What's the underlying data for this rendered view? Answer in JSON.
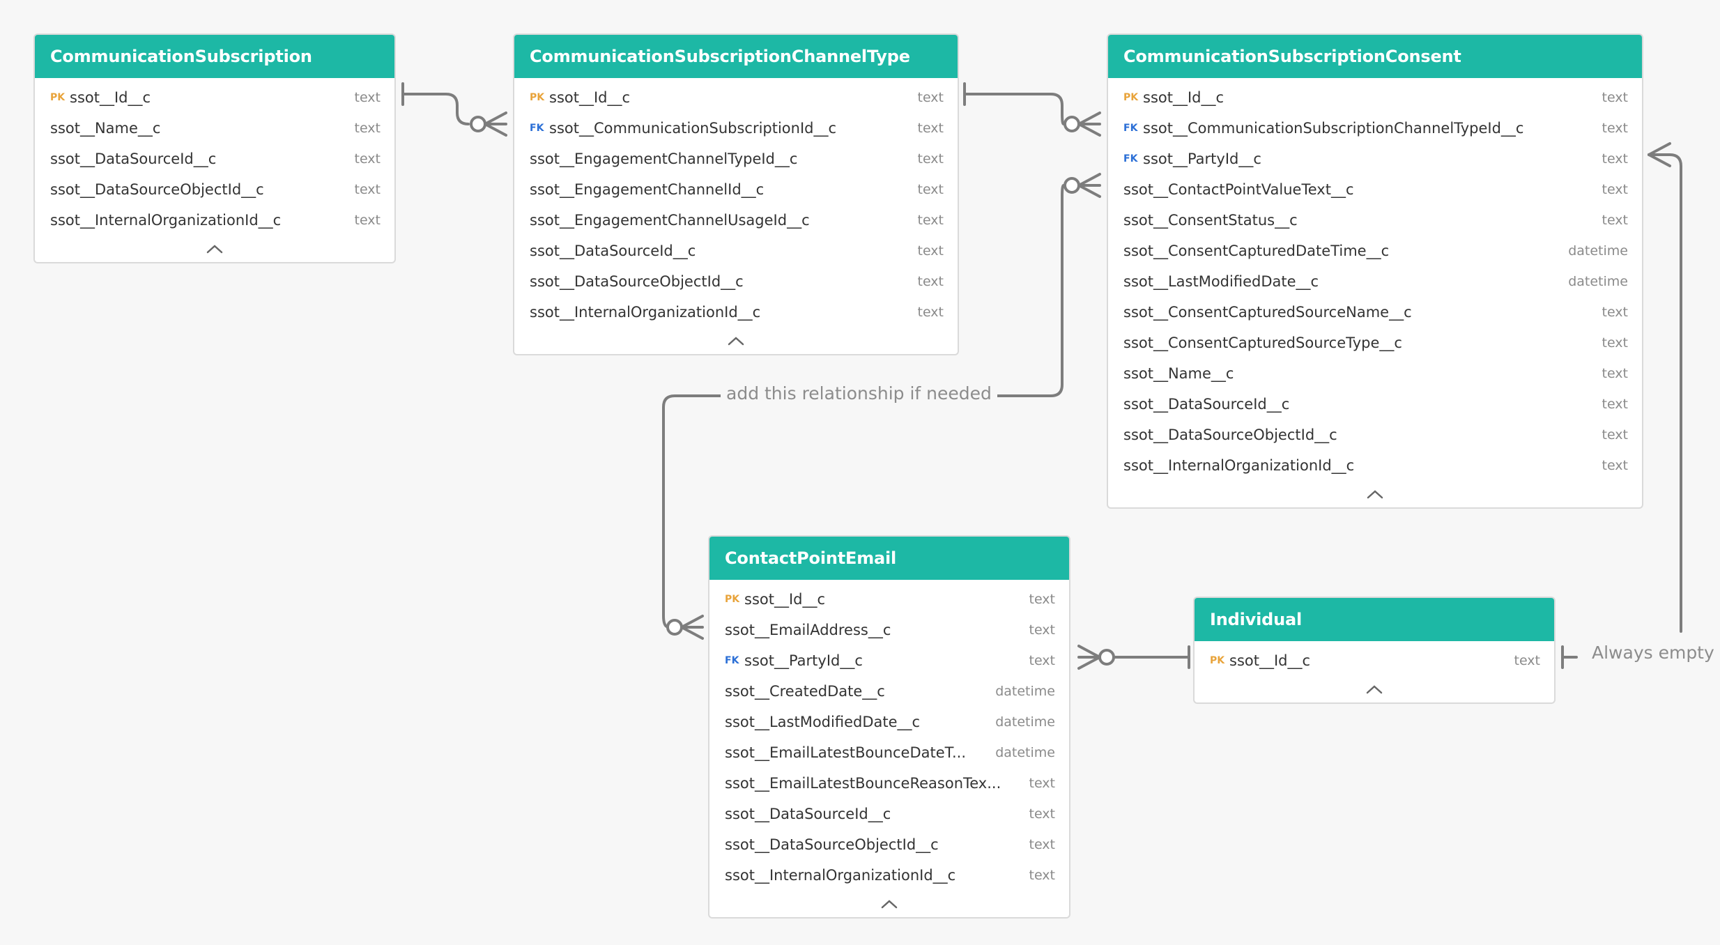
{
  "entities": {
    "communication_subscription": {
      "title": "CommunicationSubscription",
      "fields": [
        {
          "key": "PK",
          "name": "ssot__Id__c",
          "type": "text"
        },
        {
          "key": "",
          "name": "ssot__Name__c",
          "type": "text"
        },
        {
          "key": "",
          "name": "ssot__DataSourceId__c",
          "type": "text"
        },
        {
          "key": "",
          "name": "ssot__DataSourceObjectId__c",
          "type": "text"
        },
        {
          "key": "",
          "name": "ssot__InternalOrganizationId__c",
          "type": "text"
        }
      ]
    },
    "channel_type": {
      "title": "CommunicationSubscriptionChannelType",
      "fields": [
        {
          "key": "PK",
          "name": "ssot__Id__c",
          "type": "text"
        },
        {
          "key": "FK",
          "name": "ssot__CommunicationSubscriptionId__c",
          "type": "text"
        },
        {
          "key": "",
          "name": "ssot__EngagementChannelTypeId__c",
          "type": "text"
        },
        {
          "key": "",
          "name": "ssot__EngagementChannelId__c",
          "type": "text"
        },
        {
          "key": "",
          "name": "ssot__EngagementChannelUsageId__c",
          "type": "text"
        },
        {
          "key": "",
          "name": "ssot__DataSourceId__c",
          "type": "text"
        },
        {
          "key": "",
          "name": "ssot__DataSourceObjectId__c",
          "type": "text"
        },
        {
          "key": "",
          "name": "ssot__InternalOrganizationId__c",
          "type": "text"
        }
      ]
    },
    "consent": {
      "title": "CommunicationSubscriptionConsent",
      "fields": [
        {
          "key": "PK",
          "name": "ssot__Id__c",
          "type": "text"
        },
        {
          "key": "FK",
          "name": "ssot__CommunicationSubscriptionChannelTypeId__c",
          "type": "text"
        },
        {
          "key": "FK",
          "name": "ssot__PartyId__c",
          "type": "text"
        },
        {
          "key": "",
          "name": "ssot__ContactPointValueText__c",
          "type": "text"
        },
        {
          "key": "",
          "name": "ssot__ConsentStatus__c",
          "type": "text"
        },
        {
          "key": "",
          "name": "ssot__ConsentCapturedDateTime__c",
          "type": "datetime"
        },
        {
          "key": "",
          "name": "ssot__LastModifiedDate__c",
          "type": "datetime"
        },
        {
          "key": "",
          "name": "ssot__ConsentCapturedSourceName__c",
          "type": "text"
        },
        {
          "key": "",
          "name": "ssot__ConsentCapturedSourceType__c",
          "type": "text"
        },
        {
          "key": "",
          "name": "ssot__Name__c",
          "type": "text"
        },
        {
          "key": "",
          "name": "ssot__DataSourceId__c",
          "type": "text"
        },
        {
          "key": "",
          "name": "ssot__DataSourceObjectId__c",
          "type": "text"
        },
        {
          "key": "",
          "name": "ssot__InternalOrganizationId__c",
          "type": "text"
        }
      ]
    },
    "contact_point_email": {
      "title": "ContactPointEmail",
      "fields": [
        {
          "key": "PK",
          "name": "ssot__Id__c",
          "type": "text"
        },
        {
          "key": "",
          "name": "ssot__EmailAddress__c",
          "type": "text"
        },
        {
          "key": "FK",
          "name": "ssot__PartyId__c",
          "type": "text"
        },
        {
          "key": "",
          "name": "ssot__CreatedDate__c",
          "type": "datetime"
        },
        {
          "key": "",
          "name": "ssot__LastModifiedDate__c",
          "type": "datetime"
        },
        {
          "key": "",
          "name": "ssot__EmailLatestBounceDateT...",
          "type": "datetime"
        },
        {
          "key": "",
          "name": "ssot__EmailLatestBounceReasonTex...",
          "type": "text"
        },
        {
          "key": "",
          "name": "ssot__DataSourceId__c",
          "type": "text"
        },
        {
          "key": "",
          "name": "ssot__DataSourceObjectId__c",
          "type": "text"
        },
        {
          "key": "",
          "name": "ssot__InternalOrganizationId__c",
          "type": "text"
        }
      ]
    },
    "individual": {
      "title": "Individual",
      "fields": [
        {
          "key": "PK",
          "name": "ssot__Id__c",
          "type": "text"
        }
      ]
    }
  },
  "annotations": {
    "optional_relationship": "add this relationship if needed",
    "always_empty": "Always empty"
  },
  "icons": {
    "collapse": "chevron-up-icon"
  },
  "colors": {
    "header": "#1db8a5",
    "pk": "#e8a33a",
    "fk": "#2b6fd6",
    "connector": "#7d7d7d"
  }
}
